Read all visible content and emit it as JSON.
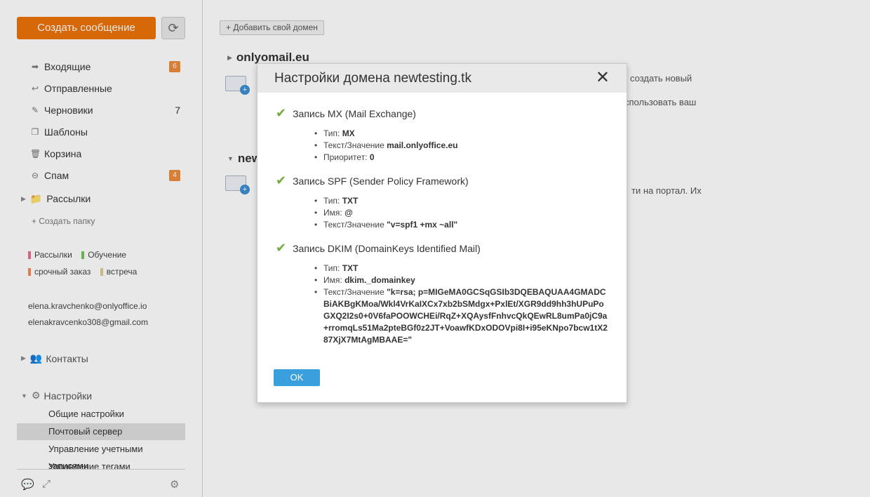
{
  "sidebar": {
    "compose_label": "Создать сообщение",
    "folders": [
      {
        "label": "Входящие",
        "badge": "6",
        "icon": "arrow-right-icon"
      },
      {
        "label": "Отправленные",
        "icon": "reply-icon"
      },
      {
        "label": "Черновики",
        "count": "7",
        "icon": "edit-icon"
      },
      {
        "label": "Шаблоны",
        "icon": "copy-icon"
      },
      {
        "label": "Корзина",
        "icon": "trash-icon"
      },
      {
        "label": "Спам",
        "badge": "4",
        "icon": "minus-circle-icon"
      }
    ],
    "mailing_label": "Рассылки",
    "create_folder_label": "Создать папку",
    "tags": [
      {
        "label": "Рассылки",
        "color": "#e56f8c"
      },
      {
        "label": "Обучение",
        "color": "#71c35d"
      },
      {
        "label": "срочный заказ",
        "color": "#ee8860"
      },
      {
        "label": "встреча",
        "color": "#d9cf8c"
      }
    ],
    "accounts": [
      "elena.kravchenko@onlyoffice.io",
      "elenakravcenko308@gmail.com"
    ],
    "contacts_label": "Контакты",
    "settings_label": "Настройки",
    "settings_items": [
      "Общие настройки",
      "Почтовый сервер",
      "Управление учетными записями",
      "Управление тегами"
    ]
  },
  "main": {
    "add_domain_label": "Добавить свой домен",
    "domains": [
      "onlyomail.eu",
      "new"
    ],
    "frag1a": "создать новый",
    "frag1b": "спользовать ваш",
    "frag2a": "ти на портал. Их"
  },
  "modal": {
    "title": "Настройки домена newtesting.tk",
    "mx": {
      "heading": "Запись MX (Mail Exchange)",
      "type_label": "Тип:",
      "type_value": "MX",
      "value_label": "Текст/Значение",
      "value_value": "mail.onlyoffice.eu",
      "priority_label": "Приоритет:",
      "priority_value": "0"
    },
    "spf": {
      "heading": "Запись SPF (Sender Policy Framework)",
      "type_label": "Тип:",
      "type_value": "TXT",
      "name_label": "Имя:",
      "name_value": "@",
      "value_label": "Текст/Значение",
      "value_value": "\"v=spf1 +mx ~all\""
    },
    "dkim": {
      "heading": "Запись DKIM (DomainKeys Identified Mail)",
      "type_label": "Тип:",
      "type_value": "TXT",
      "name_label": "Имя:",
      "name_value": "dkim._domainkey",
      "value_label": "Текст/Значение",
      "value_value": "\"k=rsa; p=MIGeMA0GCSqGSIb3DQEBAQUAA4GMADCBiAKBgKMoa/Wkl4VrKaIXCx7xb2bSMdgx+PxlEt/XGR9dd9hh3hUPuPoGXQ2I2s0+0V6faPOOWCHEi/RqZ+XQAysfFnhvcQkQEwRL8umPa0jC9a+rromqLs51Ma2pteBGf0z2JT+VoawfKDxODOVpi8I+i95eKNpo7bcw1tX287XjX7MtAgMBAAE=\""
    },
    "ok_label": "OK"
  }
}
